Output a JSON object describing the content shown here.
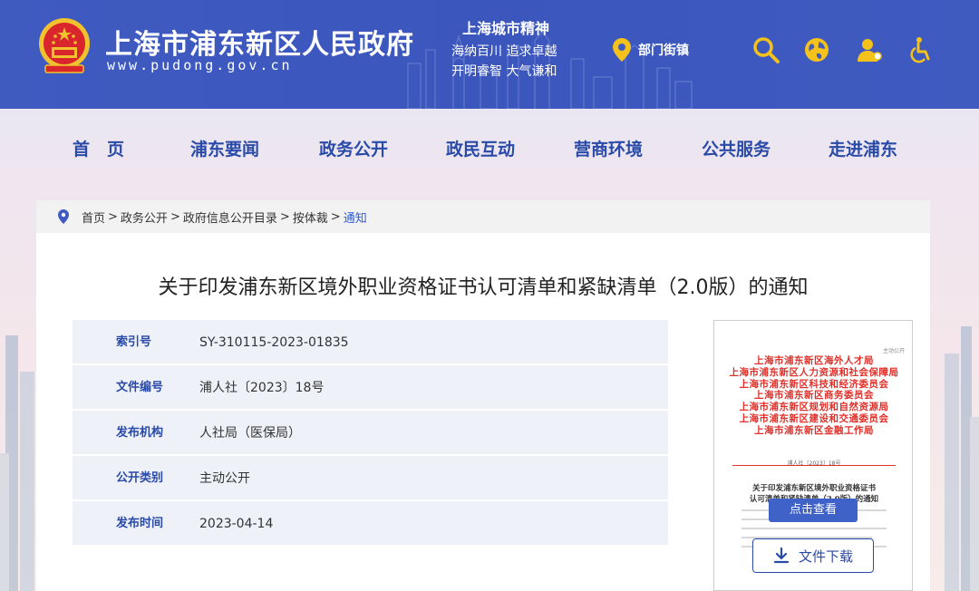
{
  "header": {
    "site_title": "上海市浦东新区人民政府",
    "site_url": "www.pudong.gov.cn",
    "spirit_title": "上海城市精神",
    "spirit_line1": "海纳百川  追求卓越",
    "spirit_line2": "开明睿智  大气谦和",
    "dept_label": "部门街镇",
    "icons": [
      "location-icon",
      "search-icon",
      "globe-icon",
      "user-icon",
      "accessibility-icon"
    ],
    "colors": {
      "header_bg": "#3f5bc0",
      "accent_yellow": "#f5c21b"
    }
  },
  "nav": {
    "items": [
      "首　页",
      "浦东要闻",
      "政务公开",
      "政民互动",
      "营商环境",
      "公共服务",
      "走进浦东"
    ]
  },
  "breadcrumb": {
    "items": [
      "首页",
      "政务公开",
      "政府信息公开目录",
      "按体裁"
    ],
    "current": "通知",
    "sep": ">"
  },
  "document": {
    "title": "关于印发浦东新区境外职业资格证书认可清单和紧缺清单（2.0版）的通知",
    "meta": [
      {
        "key": "索引号",
        "value": "SY-310115-2023-01835"
      },
      {
        "key": "文件编号",
        "value": "浦人社〔2023〕18号"
      },
      {
        "key": "发布机构",
        "value": "人社局（医保局）"
      },
      {
        "key": "公开类别",
        "value": "主动公开"
      },
      {
        "key": "发布时间",
        "value": "2023-04-14"
      }
    ]
  },
  "preview": {
    "corner_label": "主动公开",
    "issuers": [
      "上海市浦东新区海外人才局",
      "上海市浦东新区人力资源和社会保障局",
      "上海市浦东新区科技和经济委员会",
      "上海市浦东新区商务委员会",
      "上海市浦东新区规划和自然资源局",
      "上海市浦东新区建设和交通委员会",
      "上海市浦东新区金融工作局"
    ],
    "doc_number": "浦人社〔2023〕18号",
    "title_line1": "关于印发浦东新区境外职业资格证书",
    "title_line2": "认可清单和紧缺清单（2.0版）的通知",
    "view_label": "点击查看",
    "download_label": "文件下载"
  }
}
